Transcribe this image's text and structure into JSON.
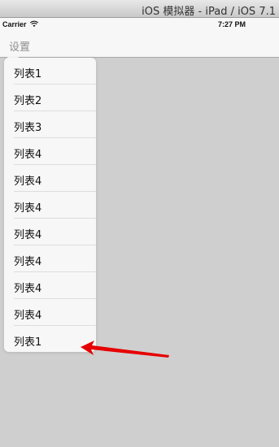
{
  "window": {
    "title": "iOS 模拟器 - iPad / iOS 7.1"
  },
  "status_bar": {
    "carrier": "Carrier",
    "time": "7:27 PM",
    "wifi_icon": "wifi-icon"
  },
  "nav_bar": {
    "left_button": "设置"
  },
  "popover": {
    "items": [
      {
        "label": "列表1"
      },
      {
        "label": "列表2"
      },
      {
        "label": "列表3"
      },
      {
        "label": "列表4"
      },
      {
        "label": "列表4"
      },
      {
        "label": "列表4"
      },
      {
        "label": "列表4"
      },
      {
        "label": "列表4"
      },
      {
        "label": "列表4"
      },
      {
        "label": "列表4"
      },
      {
        "label": "列表1"
      }
    ]
  },
  "annotation": {
    "arrow_color": "#e60000"
  },
  "colors": {
    "background": "#cfcfcf",
    "bar": "#f7f7f7",
    "popover": "#f7f7f7"
  }
}
